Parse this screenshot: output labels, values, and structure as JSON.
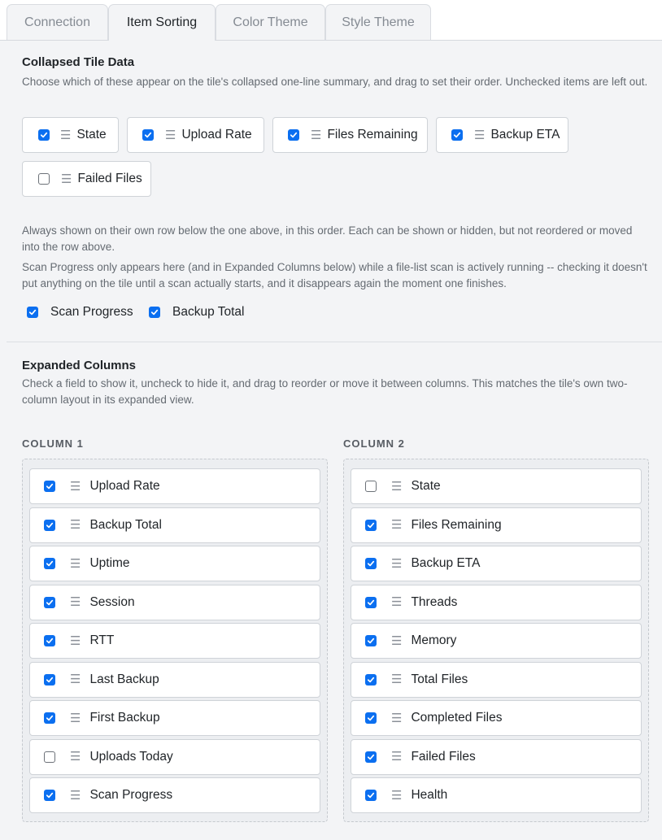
{
  "tabs": [
    "Connection",
    "Item Sorting",
    "Color Theme",
    "Style Theme"
  ],
  "active_tab": "Item Sorting",
  "collapsed": {
    "title": "Collapsed Tile Data",
    "description": "Choose which of these appear on the tile's collapsed one-line summary, and drag to set their order. Unchecked items are left out.",
    "items": [
      {
        "label": "State",
        "checked": true
      },
      {
        "label": "Upload Rate",
        "checked": true
      },
      {
        "label": "Files Remaining",
        "checked": true
      },
      {
        "label": "Backup ETA",
        "checked": true
      },
      {
        "label": "Failed Files",
        "checked": false
      }
    ]
  },
  "second_row": {
    "description1": "Always shown on their own row below the one above, in this order. Each can be shown or hidden, but not reordered or moved into the row above.",
    "description2": "Scan Progress only appears here (and in Expanded Columns below) while a file-list scan is actively running -- checking it doesn't put anything on the tile until a scan actually starts, and it disappears again the moment one finishes.",
    "items": [
      {
        "label": "Scan Progress",
        "checked": true
      },
      {
        "label": "Backup Total",
        "checked": true
      }
    ]
  },
  "expanded": {
    "title": "Expanded Columns",
    "description": "Check a field to show it, uncheck to hide it, and drag to reorder or move it between columns. This matches the tile's own two-column layout in its expanded view.",
    "column1": {
      "heading": "COLUMN 1",
      "items": [
        {
          "label": "Upload Rate",
          "checked": true
        },
        {
          "label": "Backup Total",
          "checked": true
        },
        {
          "label": "Uptime",
          "checked": true
        },
        {
          "label": "Session",
          "checked": true
        },
        {
          "label": "RTT",
          "checked": true
        },
        {
          "label": "Last Backup",
          "checked": true
        },
        {
          "label": "First Backup",
          "checked": true
        },
        {
          "label": "Uploads Today",
          "checked": false
        },
        {
          "label": "Scan Progress",
          "checked": true
        }
      ]
    },
    "column2": {
      "heading": "COLUMN 2",
      "items": [
        {
          "label": "State",
          "checked": false
        },
        {
          "label": "Files Remaining",
          "checked": true
        },
        {
          "label": "Backup ETA",
          "checked": true
        },
        {
          "label": "Threads",
          "checked": true
        },
        {
          "label": "Memory",
          "checked": true
        },
        {
          "label": "Total Files",
          "checked": true
        },
        {
          "label": "Completed Files",
          "checked": true
        },
        {
          "label": "Failed Files",
          "checked": true
        },
        {
          "label": "Health",
          "checked": true
        }
      ]
    }
  },
  "icons": {
    "drag": "drag-handle-icon",
    "check": "checkmark-icon"
  },
  "colors": {
    "accent": "#0b6ff0",
    "background": "#f3f4f6",
    "surface": "#ffffff"
  }
}
